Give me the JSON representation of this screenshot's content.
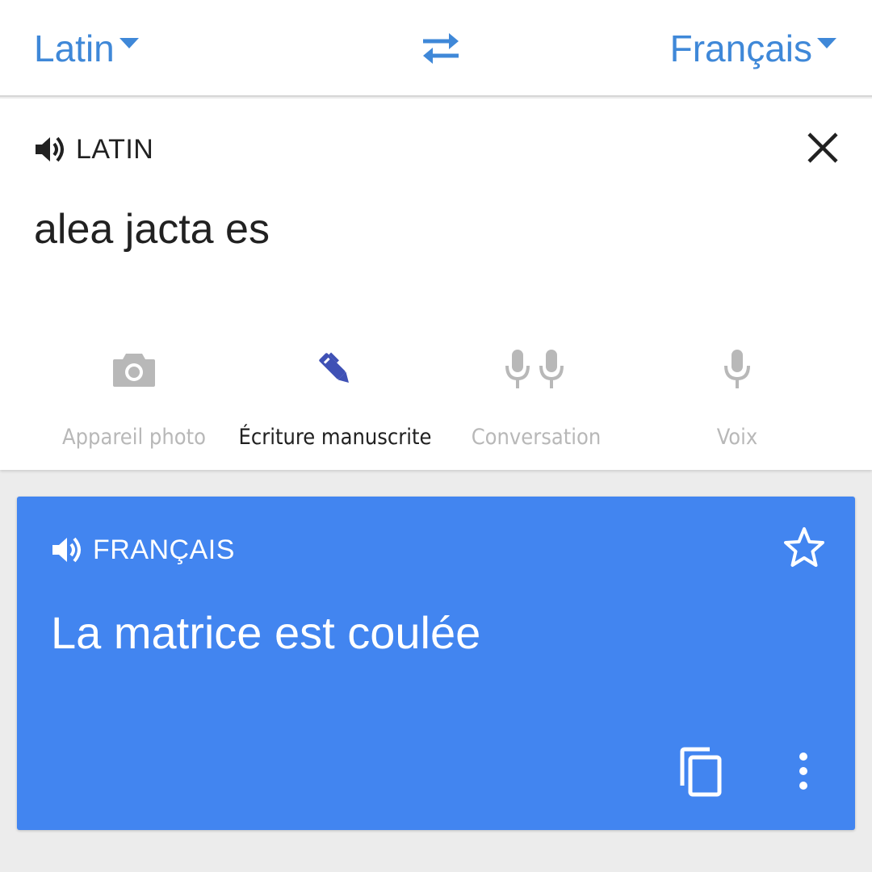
{
  "top_bar": {
    "source_language": "Latin",
    "target_language": "Français",
    "swap_icon": "swap-arrows-icon"
  },
  "input_panel": {
    "language_label": "LATIN",
    "speaker_icon": "speaker-icon",
    "clear_icon": "close-icon",
    "text": "alea jacta es",
    "tools": [
      {
        "icon": "camera-icon",
        "label": "Appareil photo",
        "active": false
      },
      {
        "icon": "pen-icon",
        "label": "Écriture manuscrite",
        "active": true
      },
      {
        "icon": "conversation-mics-icon",
        "label": "Conversation",
        "active": false
      },
      {
        "icon": "microphone-icon",
        "label": "Voix",
        "active": false
      }
    ]
  },
  "result_card": {
    "language_label": "FRANÇAIS",
    "speaker_icon": "speaker-icon",
    "star_icon": "star-outline-icon",
    "text": "La matrice est coulée",
    "copy_icon": "copy-icon",
    "more_icon": "more-vert-icon"
  },
  "colors": {
    "accent": "#3f88d8",
    "card_blue": "#4285f0",
    "active_tool": "#3f51b5",
    "inactive_tool": "#b8b8b8",
    "background": "#ececec"
  }
}
